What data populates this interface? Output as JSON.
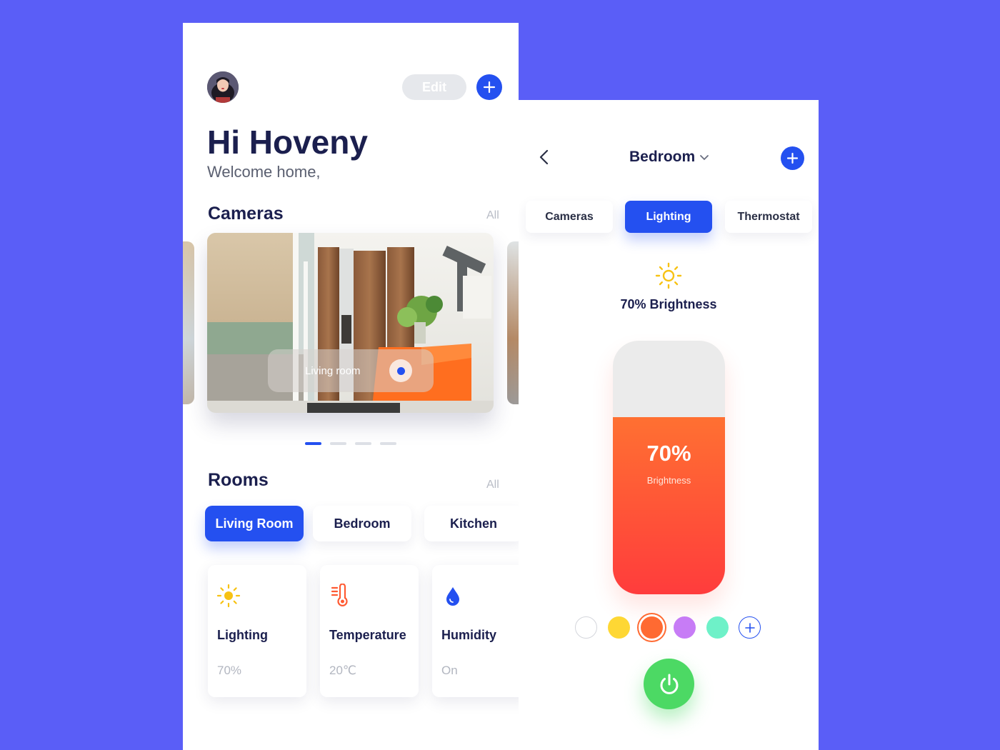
{
  "left_screen": {
    "header": {
      "edit_label": "Edit",
      "greeting": "Hi Hoveny",
      "welcome": "Welcome home,"
    },
    "cameras": {
      "title": "Cameras",
      "all_label": "All",
      "active_camera_label": "Living room",
      "page_count": 4,
      "active_page": 1
    },
    "rooms": {
      "title": "Rooms",
      "all_label": "All",
      "tabs": [
        {
          "label": "Living Room",
          "active": true
        },
        {
          "label": "Bedroom",
          "active": false
        },
        {
          "label": "Kitchen",
          "active": false
        }
      ]
    },
    "devices": [
      {
        "name": "Lighting",
        "value": "70%",
        "icon": "sun-icon"
      },
      {
        "name": "Temperature",
        "value": "20℃",
        "icon": "thermometer-icon"
      },
      {
        "name": "Humidity",
        "value": "On",
        "icon": "water-drop-icon"
      }
    ]
  },
  "right_screen": {
    "header": {
      "room_title": "Bedroom"
    },
    "categories": [
      {
        "label": "Cameras",
        "active": false
      },
      {
        "label": "Lighting",
        "active": true
      },
      {
        "label": "Thermostat",
        "active": false
      }
    ],
    "brightness": {
      "summary": "70% Brightness",
      "value_text": "70%",
      "label": "Brightness",
      "level": 0.7
    },
    "colors": [
      {
        "hex": "#ffffff",
        "selected": false
      },
      {
        "hex": "#fed734",
        "selected": false
      },
      {
        "hex": "#ff6a32",
        "selected": true
      },
      {
        "hex": "#c77cf6",
        "selected": false
      },
      {
        "hex": "#6ef1c8",
        "selected": false
      }
    ],
    "power_on": true
  },
  "theme": {
    "background": "#5a5ef7",
    "accent": "#2450f0",
    "power": "#4cd964",
    "sun": "#f7c214",
    "thermometer": "#ff5a32"
  }
}
